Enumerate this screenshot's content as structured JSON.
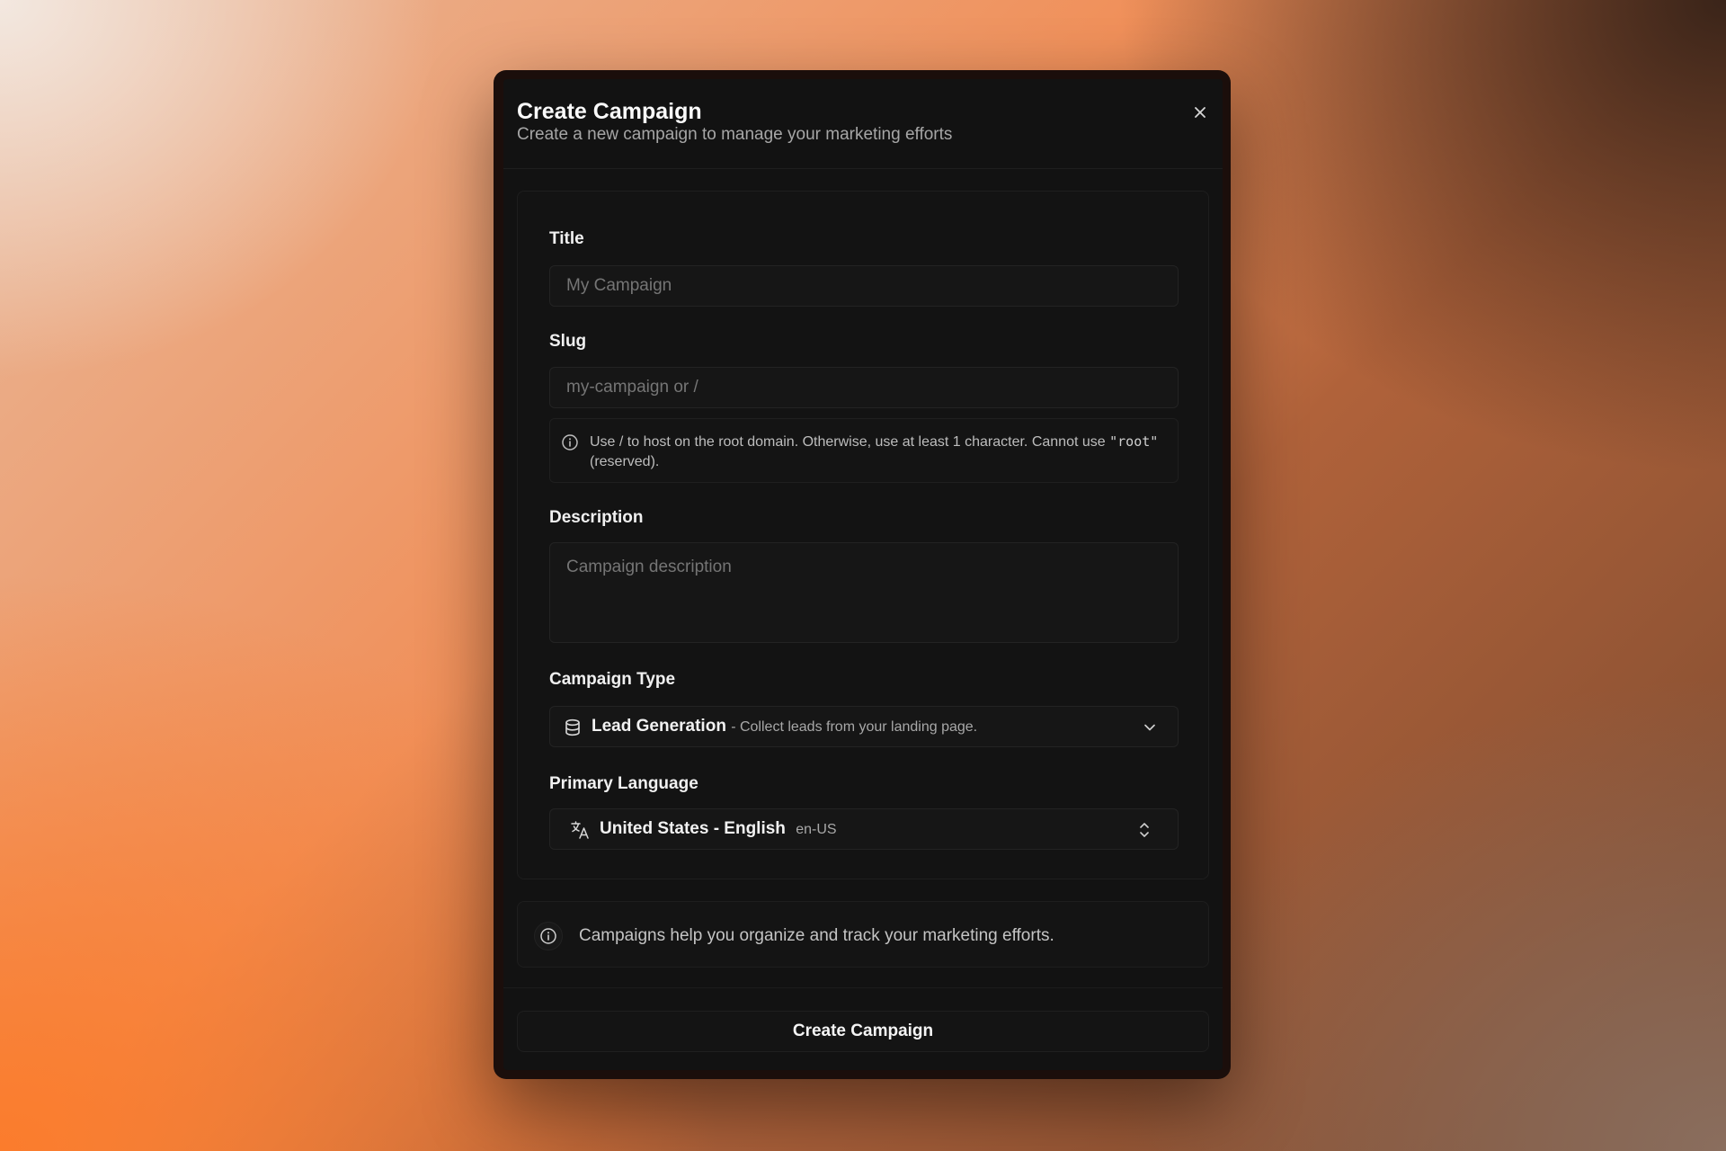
{
  "dialog": {
    "title": "Create Campaign",
    "subtitle": "Create a new campaign to manage your marketing efforts",
    "close_icon": "close-icon"
  },
  "form": {
    "title_label": "Title",
    "title_placeholder": "My Campaign",
    "slug_label": "Slug",
    "slug_placeholder": "my-campaign or /",
    "slug_hint_part1": "Use / to host on the root domain. Otherwise, use at least 1 character. Cannot use",
    "slug_hint_code": "\"root\"",
    "slug_hint_part2": "(reserved).",
    "description_label": "Description",
    "description_placeholder": "Campaign description",
    "campaign_type_label": "Campaign Type",
    "campaign_type_value": "Lead Generation",
    "campaign_type_detail": "- Collect leads from your landing page.",
    "primary_language_label": "Primary Language",
    "language_value": "United States - English",
    "language_code": "en-US"
  },
  "note": {
    "text": "Campaigns help you organize and track your marketing efforts."
  },
  "footer": {
    "submit_label": "Create Campaign"
  },
  "icons": {
    "close": "close-icon",
    "info": "info-icon",
    "database": "database-icon",
    "translate": "translate-icon",
    "chevron_down": "chevron-down-icon",
    "chevron_up_down": "chevron-up-down-icon"
  }
}
